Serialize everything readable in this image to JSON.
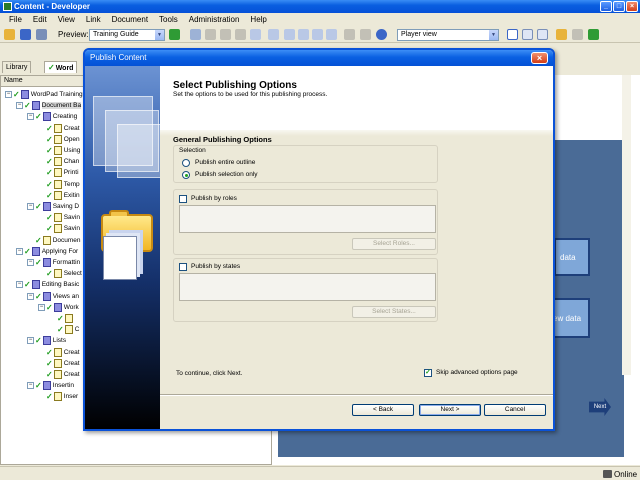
{
  "app": {
    "title": "Content - Developer",
    "status_text": "Online"
  },
  "menu": [
    "File",
    "Edit",
    "View",
    "Link",
    "Document",
    "Tools",
    "Administration",
    "Help"
  ],
  "toolbar": {
    "preview_label": "Preview:",
    "preview_value": "Training Guide",
    "view_value": "Player view"
  },
  "panel": {
    "tabs": [
      "Library",
      "Word"
    ],
    "column_header": "Name",
    "tree": [
      {
        "text": "WordPad Training",
        "level": 0,
        "type": "book"
      },
      {
        "text": "Document Ba",
        "level": 1,
        "type": "book"
      },
      {
        "text": "Creating",
        "level": 2,
        "type": "book"
      },
      {
        "text": "Creat",
        "level": 3,
        "type": "page"
      },
      {
        "text": "Open",
        "level": 3,
        "type": "page"
      },
      {
        "text": "Using",
        "level": 3,
        "type": "page"
      },
      {
        "text": "Chan",
        "level": 3,
        "type": "page"
      },
      {
        "text": "Printi",
        "level": 3,
        "type": "page"
      },
      {
        "text": "Temp",
        "level": 3,
        "type": "page"
      },
      {
        "text": "Exitin",
        "level": 3,
        "type": "page"
      },
      {
        "text": "Saving D",
        "level": 2,
        "type": "book"
      },
      {
        "text": "Savin",
        "level": 3,
        "type": "page"
      },
      {
        "text": "Savin",
        "level": 3,
        "type": "page"
      },
      {
        "text": "Documen",
        "level": 2,
        "type": "page"
      },
      {
        "text": "Applying For",
        "level": 1,
        "type": "book"
      },
      {
        "text": "Formattin",
        "level": 2,
        "type": "book"
      },
      {
        "text": "Select",
        "level": 3,
        "type": "page"
      },
      {
        "text": "Editing Basic",
        "level": 1,
        "type": "book"
      },
      {
        "text": "Views an",
        "level": 2,
        "type": "book"
      },
      {
        "text": "Work",
        "level": 3,
        "type": "book"
      },
      {
        "text": "",
        "level": 4,
        "type": "page"
      },
      {
        "text": "C",
        "level": 4,
        "type": "page"
      },
      {
        "text": "Lists",
        "level": 2,
        "type": "book"
      },
      {
        "text": "Creat",
        "level": 3,
        "type": "page"
      },
      {
        "text": "Creat",
        "level": 3,
        "type": "page"
      },
      {
        "text": "Creat",
        "level": 3,
        "type": "page"
      },
      {
        "text": "Insertin",
        "level": 2,
        "type": "book"
      },
      {
        "text": "Inser",
        "level": 3,
        "type": "page"
      }
    ]
  },
  "preview": {
    "box1": "data",
    "box2": "ew data",
    "next_arrow": "Next"
  },
  "dialog": {
    "title": "Publish Content",
    "heading": "Select Publishing Options",
    "subheading": "Set the options to be used for this publishing process.",
    "section_title": "General Publishing Options",
    "selection_label": "Selection",
    "radio_entire": "Publish entire outline",
    "radio_selection": "Publish selection only",
    "roles_label": "Publish by roles",
    "select_roles_button": "Select Roles...",
    "states_label": "Publish by states",
    "select_states_button": "Select States...",
    "continue_text": "To continue, click Next.",
    "skip_label": "Skip advanced options page",
    "back_button": "< Back",
    "next_button": "Next >",
    "cancel_button": "Cancel"
  },
  "colors": {
    "title_blue": "#0a5fe0",
    "check_green": "#1f9c1f",
    "preview_blue": "#4a6b96"
  }
}
